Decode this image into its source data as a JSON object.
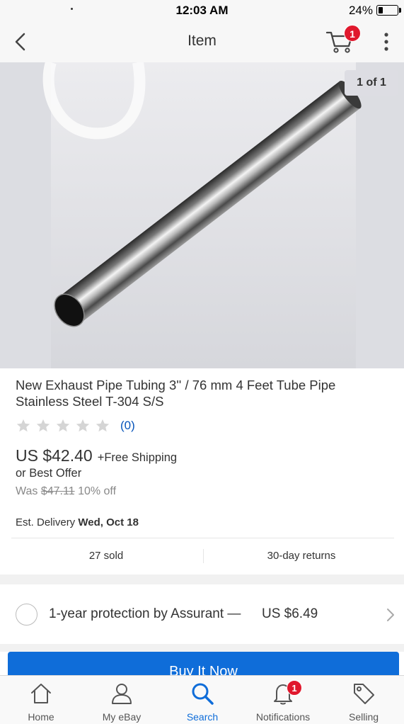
{
  "status_bar": {
    "time": "12:03 AM",
    "battery_percent": "24%",
    "battery_level": 0.24
  },
  "nav": {
    "title": "Item",
    "cart_count": "1",
    "icons": [
      "chevron-left-icon",
      "cart-icon",
      "more-vertical-icon"
    ]
  },
  "gallery": {
    "counter": "1 of 1"
  },
  "item": {
    "title": "New Exhaust Pipe Tubing 3'' / 76 mm 4 Feet  Tube Pipe Stainless Steel T-304 S/S",
    "rating_stars": 0,
    "rating_count": "(0)",
    "price": "US $42.40",
    "shipping": "+Free Shipping",
    "best_offer": "or Best Offer",
    "was_label": "Was",
    "was_price": "$47.11",
    "discount": "10% off",
    "delivery_label": "Est. Delivery",
    "delivery_date": "Wed, Oct 18",
    "sold": "27 sold",
    "returns": "30-day returns"
  },
  "protection": {
    "label": "1-year protection by Assurant —",
    "price": "US $6.49"
  },
  "buy_button": {
    "label": "Buy It Now"
  },
  "tabs": [
    {
      "label": "Home",
      "icon": "home-icon",
      "active": false
    },
    {
      "label": "My eBay",
      "icon": "person-icon",
      "active": false
    },
    {
      "label": "Search",
      "icon": "search-icon",
      "active": true
    },
    {
      "label": "Notifications",
      "icon": "bell-icon",
      "active": false,
      "badge": "1"
    },
    {
      "label": "Selling",
      "icon": "tag-icon",
      "active": false
    }
  ],
  "colors": {
    "accent": "#0f6dd9",
    "link": "#0654ba",
    "badge": "#e0182d"
  }
}
